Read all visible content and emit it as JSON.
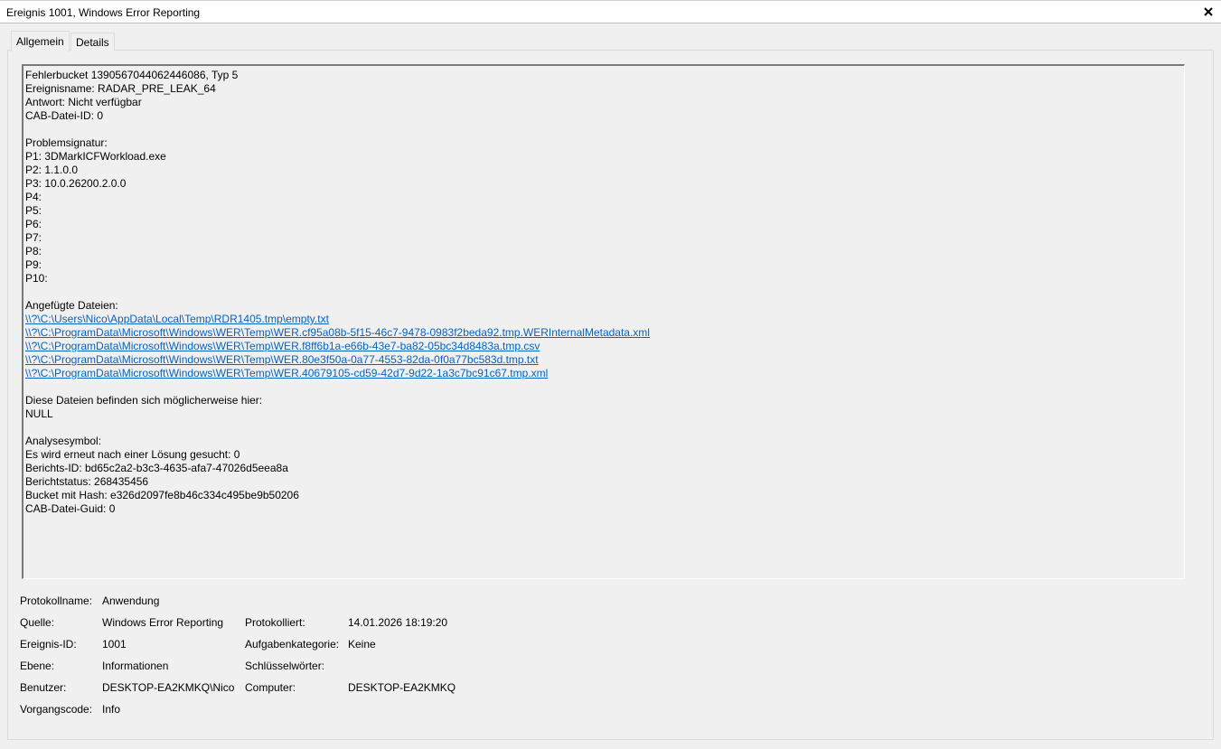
{
  "window": {
    "title": "Ereignis 1001, Windows Error Reporting",
    "close_glyph": "✕"
  },
  "tabs": [
    {
      "label": "Allgemein",
      "active": true
    },
    {
      "label": "Details",
      "active": false
    }
  ],
  "description": {
    "header": [
      "Fehlerbucket 1390567044062446086, Typ 5",
      "Ereignisname: RADAR_PRE_LEAK_64",
      "Antwort: Nicht verfügbar",
      "CAB-Datei-ID: 0"
    ],
    "signature_title": "Problemsignatur:",
    "signature": [
      "P1: 3DMarkICFWorkload.exe",
      "P2: 1.1.0.0",
      "P3: 10.0.26200.2.0.0",
      "P4:",
      "P5:",
      "P6:",
      "P7:",
      "P8:",
      "P9:",
      "P10:"
    ],
    "attached_title": "Angefügte Dateien:",
    "attached_files": [
      "\\\\?\\C:\\Users\\Nico\\AppData\\Local\\Temp\\RDR1405.tmp\\empty.txt",
      "\\\\?\\C:\\ProgramData\\Microsoft\\Windows\\WER\\Temp\\WER.cf95a08b-5f15-46c7-9478-0983f2beda92.tmp.WERInternalMetadata.xml",
      "\\\\?\\C:\\ProgramData\\Microsoft\\Windows\\WER\\Temp\\WER.f8ff6b1a-e66b-43e7-ba82-05bc34d8483a.tmp.csv",
      "\\\\?\\C:\\ProgramData\\Microsoft\\Windows\\WER\\Temp\\WER.80e3f50a-0a77-4553-82da-0f0a77bc583d.tmp.txt",
      "\\\\?\\C:\\ProgramData\\Microsoft\\Windows\\WER\\Temp\\WER.40679105-cd59-42d7-9d22-1a3c7bc91c67.tmp.xml"
    ],
    "location_title": "Diese Dateien befinden sich möglicherweise hier:",
    "location_value": "NULL",
    "analysis": [
      "Analysesymbol:",
      "Es wird erneut nach einer Lösung gesucht: 0",
      "Berichts-ID: bd65c2a2-b3c3-4635-afa7-47026d5eea8a",
      "Berichtstatus: 268435456",
      "Bucket mit Hash: e326d2097fe8b46c334c495be9b50206",
      "CAB-Datei-Guid: 0"
    ]
  },
  "meta": {
    "log_name_label": "Protokollname:",
    "log_name_value": "Anwendung",
    "source_label": "Quelle:",
    "source_value": "Windows Error Reporting",
    "logged_label": "Protokolliert:",
    "logged_value": "14.01.2026 18:19:20",
    "event_id_label": "Ereignis-ID:",
    "event_id_value": "1001",
    "task_category_label": "Aufgabenkategorie:",
    "task_category_value": "Keine",
    "level_label": "Ebene:",
    "level_value": "Informationen",
    "keywords_label": "Schlüsselwörter:",
    "keywords_value": "",
    "user_label": "Benutzer:",
    "user_value": "DESKTOP-EA2KMKQ\\Nico",
    "computer_label": "Computer:",
    "computer_value": "DESKTOP-EA2KMKQ",
    "opcode_label": "Vorgangscode:",
    "opcode_value": "Info"
  }
}
